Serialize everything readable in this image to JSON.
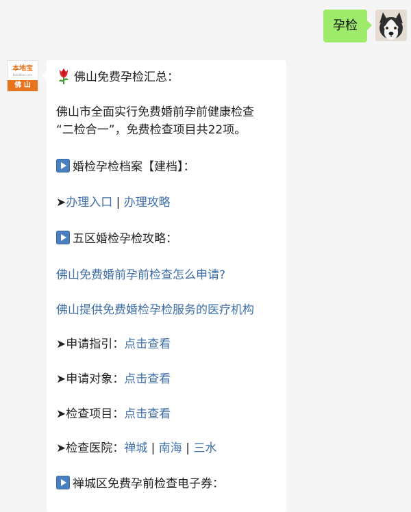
{
  "outgoing": {
    "text": "孕检"
  },
  "brand": {
    "name": "本地宝",
    "url": "Bendibao.com",
    "city": "佛 山"
  },
  "message": {
    "title": "佛山免费孕检汇总：",
    "intro_line1": "佛山市全面实行免费婚前孕前健康检查",
    "intro_line2": "“二检合一”，免费检查项目共22项。",
    "section1": "婚检孕检档案【建档】：",
    "arrow": "➤",
    "entry_link": "办理入口",
    "separator": " | ",
    "guide_link": "办理攻略",
    "section2": "五区婚检孕检攻略：",
    "apply_link": "佛山免费婚前孕前检查怎么申请?",
    "institutions_link": "佛山提供免费婚检孕检服务的医疗机构",
    "guide_label": "申请指引：",
    "target_label": "申请对象：",
    "items_label": "检查项目：",
    "hospital_label": "检查医院：",
    "view_link": "点击查看",
    "chancheng": "禅城",
    "nanhai": "南海",
    "sanshui": "三水",
    "section3": "禅城区免费孕前检查电子券："
  },
  "colors": {
    "bubble_green": "#9eea6a",
    "link_blue": "#3e6ea8",
    "brand_orange": "#e8741e"
  },
  "icons": {
    "title": "tulip-icon",
    "sections": "play-button-icon"
  }
}
